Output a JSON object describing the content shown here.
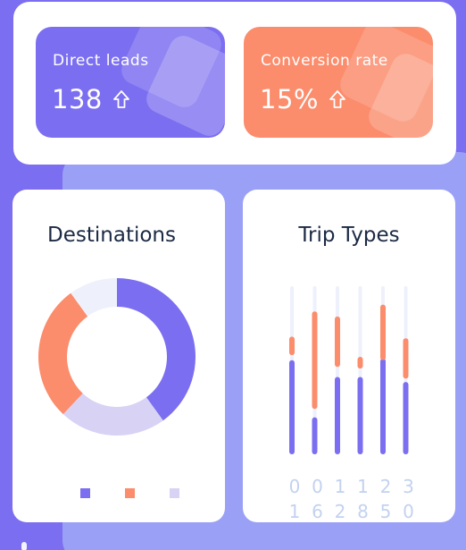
{
  "stats": {
    "direct_leads": {
      "label": "Direct leads",
      "value": "138",
      "arrow_icon": "arrow-up-icon"
    },
    "conversion_rate": {
      "label": "Conversion rate",
      "value": "15%",
      "arrow_icon": "arrow-up-icon"
    }
  },
  "destinations": {
    "title": "Destinations"
  },
  "trip_types": {
    "title": "Trip Types",
    "x_labels": [
      [
        "0",
        "1"
      ],
      [
        "0",
        "6"
      ],
      [
        "1",
        "2"
      ],
      [
        "1",
        "8"
      ],
      [
        "2",
        "5"
      ],
      [
        "3",
        "0"
      ]
    ]
  },
  "colors": {
    "purple": "#7b6ef0",
    "orange": "#fb8c6c",
    "lavender": "#d8d2f4",
    "track": "#eef1fb",
    "title": "#1c2a44"
  },
  "chart_data": [
    {
      "type": "pie",
      "title": "Destinations",
      "slices": [
        {
          "value": 40,
          "color": "#7b6ef0"
        },
        {
          "value": 22,
          "color": "#d8d2f4"
        },
        {
          "value": 28,
          "color": "#fb8c6c"
        },
        {
          "value": 10,
          "color": "#eef1fb"
        }
      ],
      "legend": [
        "#7b6ef0",
        "#fb8c6c",
        "#d8d2f4"
      ],
      "legend_placement": "bottom"
    },
    {
      "type": "bar",
      "title": "Trip Types",
      "categories": [
        "01",
        "06",
        "12",
        "18",
        "25",
        "30"
      ],
      "ylim": [
        0,
        100
      ],
      "series": [
        {
          "color": "#7b6ef0",
          "values": [
            56,
            22,
            46,
            46,
            57,
            43
          ]
        },
        {
          "color": "#fb8c6c",
          "segments": [
            [
              59,
              70
            ],
            [
              27,
              85
            ],
            [
              52,
              82
            ],
            [
              51,
              58
            ],
            [
              56,
              89
            ],
            [
              45,
              69
            ]
          ]
        }
      ]
    }
  ]
}
